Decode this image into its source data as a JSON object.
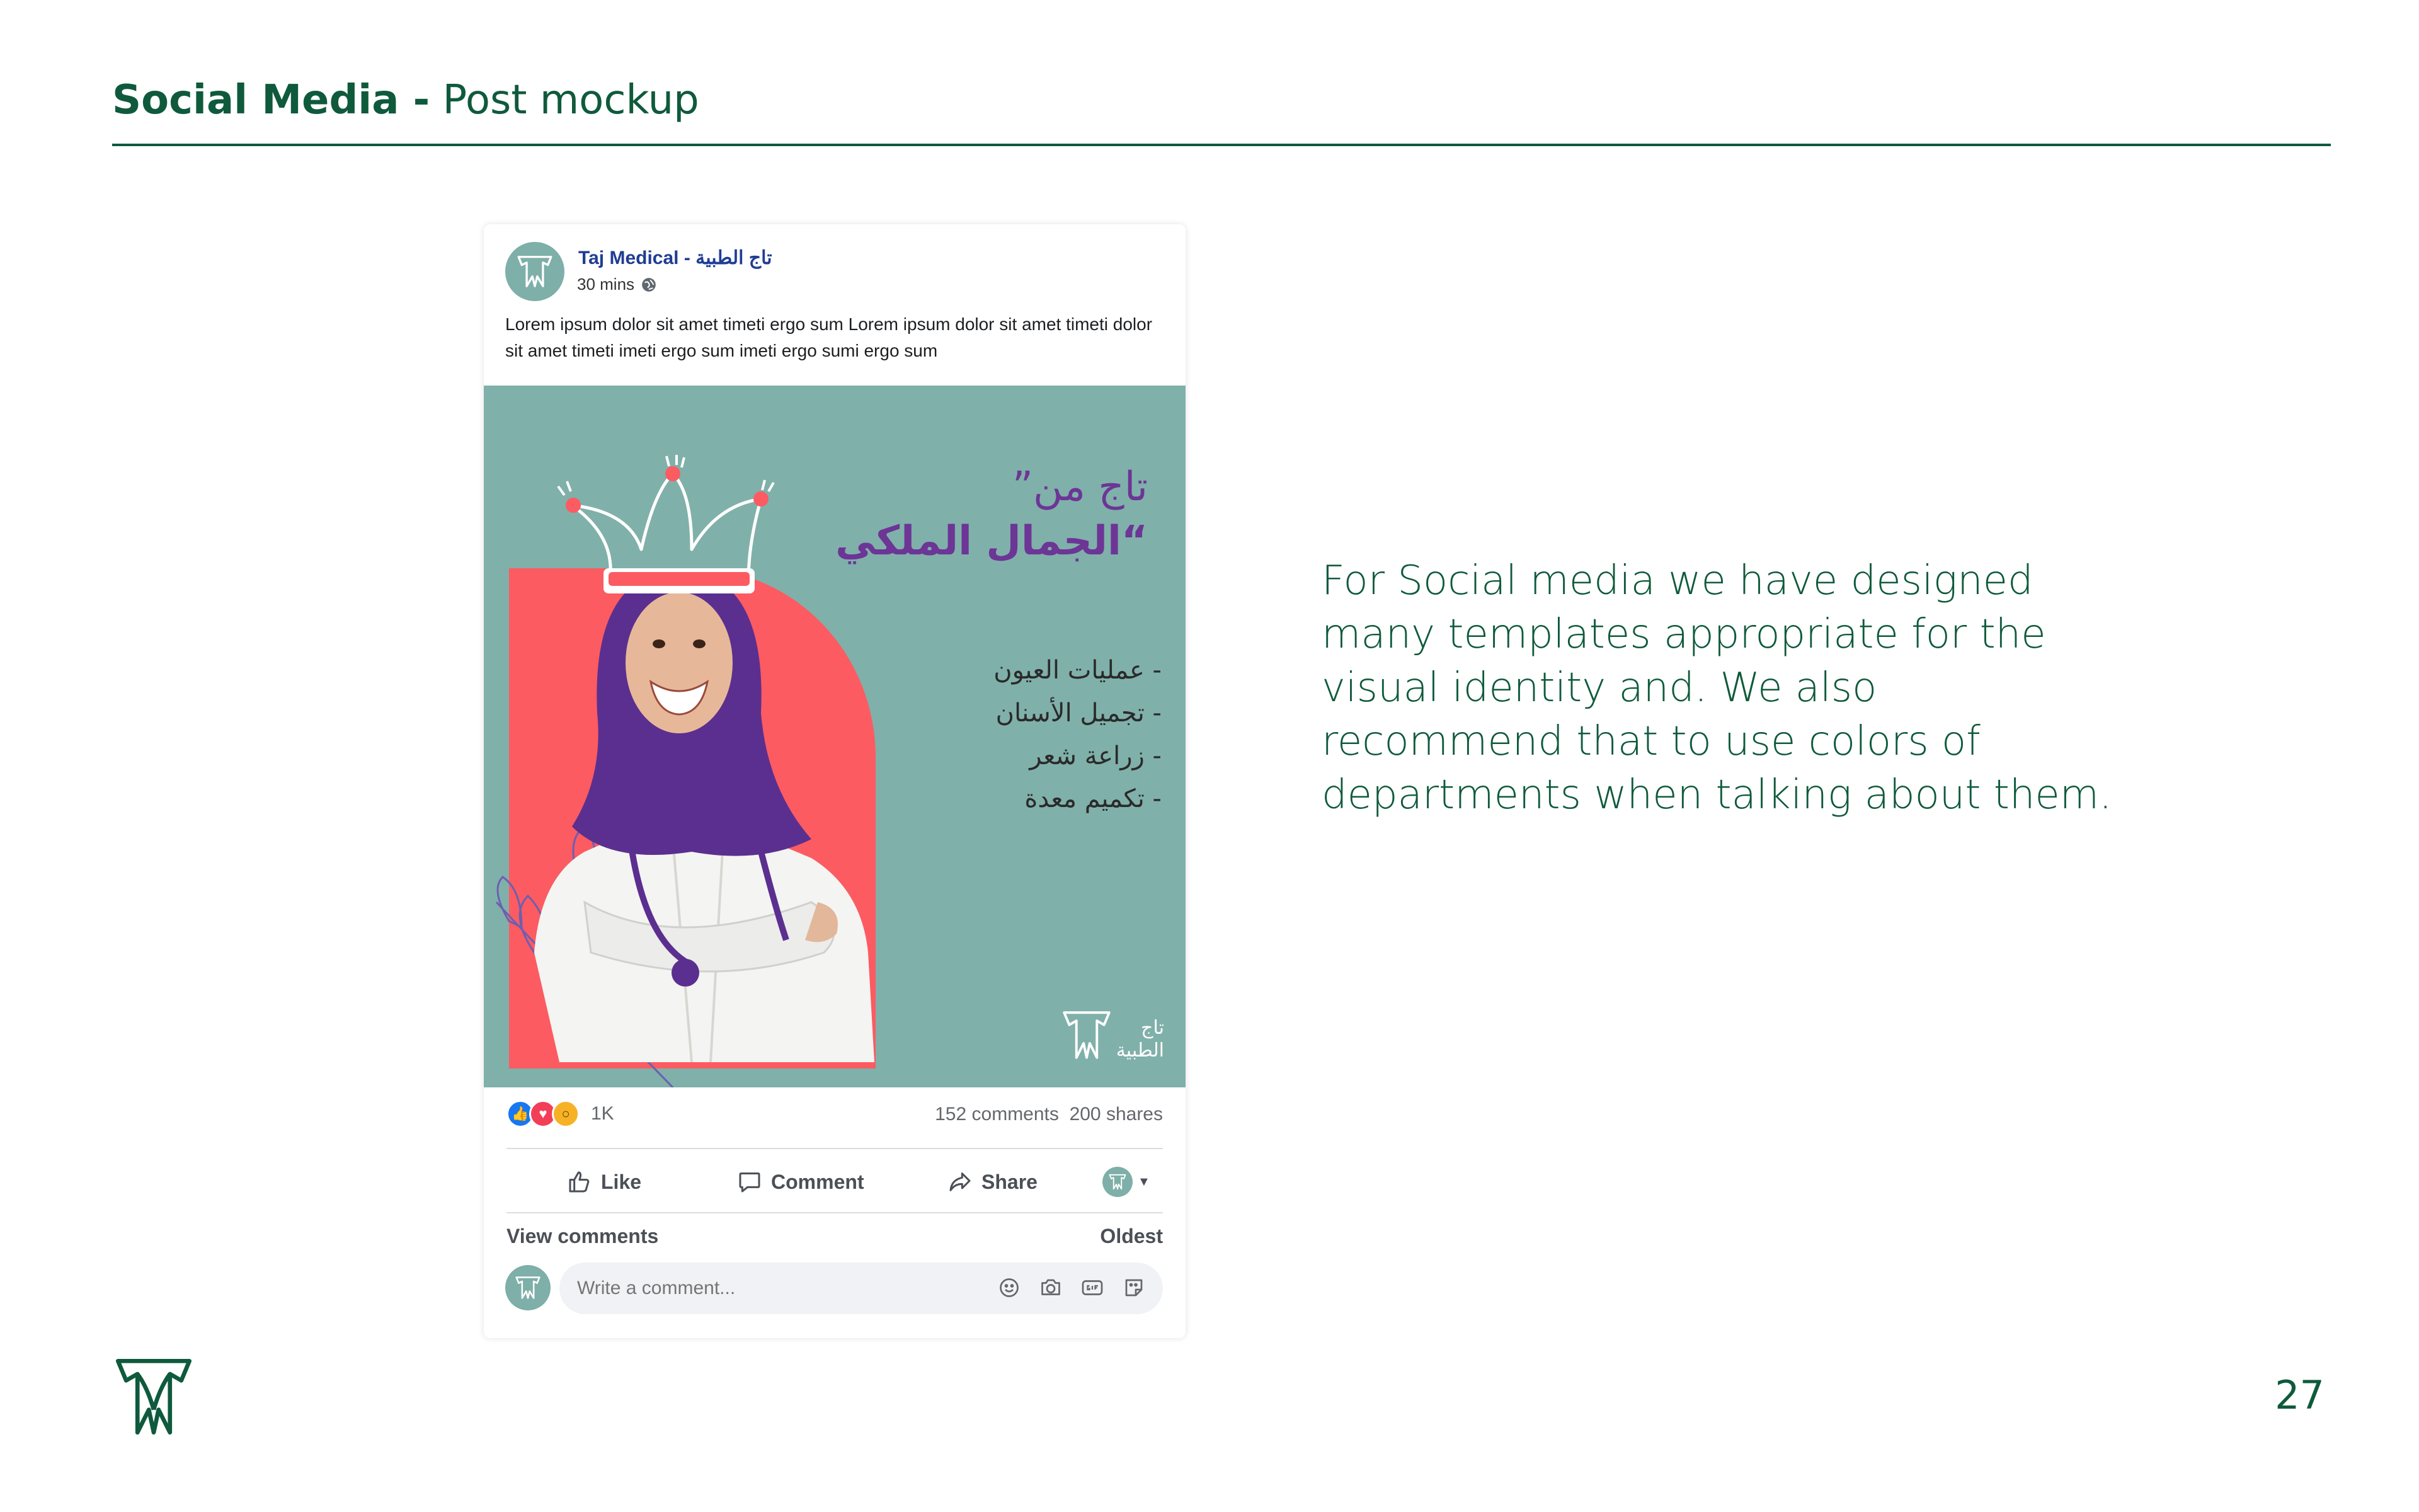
{
  "slide": {
    "title_bold": "Social Media -",
    "title_regular": "Post mockup",
    "description": "For Social media we have designed many templates appropriate for the visual identity and. We also recommend that to use colors of departments when talking about them.",
    "page_number": "27"
  },
  "post": {
    "page_name": "Taj Medical - تاج الطبية",
    "time": "30 mins",
    "text": "Lorem ipsum dolor sit amet timeti ergo sum Lorem ipsum dolor sit amet timeti dolor sit amet timeti imeti ergo sum imeti ergo sumi ergo sum",
    "image": {
      "headline_line1": "”تاج من",
      "headline_line2": "الجمال الملكي“",
      "services": [
        "عمليات العيون -",
        "تجميل الأسنان -",
        "زراعة شعر -",
        "تكميم معدة -"
      ],
      "logo_word_line1": "تاج",
      "logo_word_line2": "الطبية"
    },
    "reactions_count": "1K",
    "comments_count": "152 comments",
    "shares_count": "200 shares",
    "actions": {
      "like": "Like",
      "comment": "Comment",
      "share": "Share"
    },
    "view_comments": "View comments",
    "sort": "Oldest",
    "comment_placeholder": "Write a comment..."
  },
  "colors": {
    "brand_green": "#0f5a3c",
    "image_teal": "#80b0aa",
    "accent_coral": "#fc5b62",
    "headline_purple": "#6c3596",
    "page_name_blue": "#1f3d93"
  },
  "icons": [
    "taj-logo-icon",
    "globe-icon",
    "like-reaction-icon",
    "love-reaction-icon",
    "wow-reaction-icon",
    "thumbs-up-icon",
    "comment-icon",
    "share-icon",
    "emoji-icon",
    "camera-icon",
    "gif-icon",
    "sticker-icon"
  ]
}
